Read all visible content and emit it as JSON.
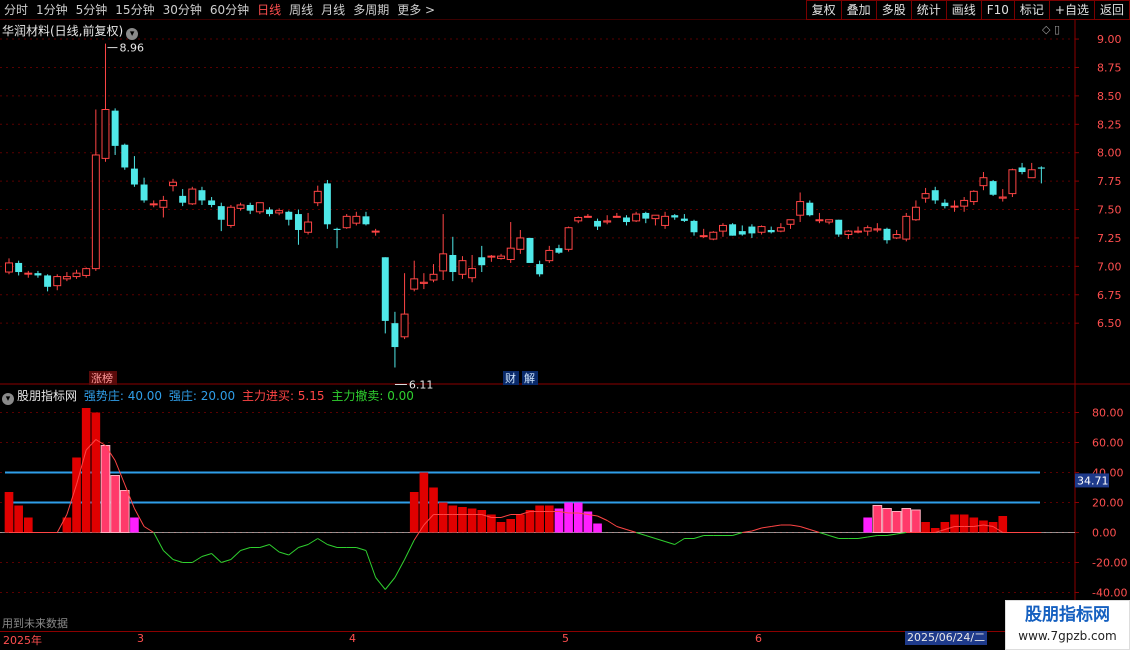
{
  "toolbar": {
    "periods": [
      {
        "label": "分时",
        "active": false
      },
      {
        "label": "1分钟",
        "active": false
      },
      {
        "label": "5分钟",
        "active": false
      },
      {
        "label": "15分钟",
        "active": false
      },
      {
        "label": "30分钟",
        "active": false
      },
      {
        "label": "60分钟",
        "active": false
      },
      {
        "label": "日线",
        "active": true
      },
      {
        "label": "周线",
        "active": false
      },
      {
        "label": "月线",
        "active": false
      },
      {
        "label": "多周期",
        "active": false
      },
      {
        "label": "更多 >",
        "active": false
      }
    ],
    "tools": [
      "复权",
      "叠加",
      "多股",
      "统计",
      "画线",
      "F10",
      "标记",
      "+自选",
      "返回"
    ]
  },
  "main": {
    "title": "华润材料(日线,前复权)",
    "title_icon": "chevron-down-icon",
    "panel_icons": "◇ ▯",
    "high_label": "8.96",
    "low_label": "6.11",
    "badges": [
      "涨榜",
      "财",
      "解"
    ],
    "price_axis": [
      "9.00",
      "8.75",
      "8.50",
      "8.25",
      "8.00",
      "7.75",
      "7.50",
      "7.25",
      "7.00",
      "6.75",
      "6.50"
    ]
  },
  "indicator": {
    "name": "股朋指标网",
    "strong": "强势庄: 40.00",
    "mid": "强庄: 20.00",
    "buy": "主力进买: 5.15",
    "sell": "主力撤卖: 0.00",
    "axis": [
      "80.00",
      "60.00",
      "40.00",
      "20.00",
      "0.00",
      "-20.00",
      "-40.00"
    ],
    "current_value": "34.71"
  },
  "footer": {
    "future_note": "用到未来数据",
    "dates": [
      "2025年",
      "3",
      "4",
      "5",
      "6"
    ],
    "cursor_date": "2025/06/24/二"
  },
  "watermark": {
    "line1": "股朋指标网",
    "line2": "www.7gpzb.com"
  },
  "colors": {
    "up": "#ff4545",
    "down": "#4fe8e8",
    "grid": "#5a0000",
    "line_blue": "#2f9ee8",
    "line_green": "#2fd02f",
    "magenta": "#ff1fff"
  },
  "chart_data": {
    "type": "candlestick",
    "candles": [
      [
        6.95,
        7.03,
        7.07,
        6.93
      ],
      [
        7.03,
        6.95,
        7.05,
        6.92
      ],
      [
        6.94,
        6.94,
        6.96,
        6.9
      ],
      [
        6.94,
        6.92,
        6.96,
        6.9
      ],
      [
        6.92,
        6.82,
        6.93,
        6.78
      ],
      [
        6.83,
        6.91,
        6.93,
        6.79
      ],
      [
        6.89,
        6.91,
        6.95,
        6.87
      ],
      [
        6.91,
        6.94,
        6.97,
        6.89
      ],
      [
        6.92,
        6.98,
        6.99,
        6.9
      ],
      [
        6.98,
        7.98,
        8.38,
        6.96
      ],
      [
        7.95,
        8.38,
        8.96,
        7.92
      ],
      [
        8.37,
        8.06,
        8.39,
        7.98
      ],
      [
        8.07,
        7.87,
        8.08,
        7.85
      ],
      [
        7.86,
        7.72,
        7.97,
        7.7
      ],
      [
        7.72,
        7.58,
        7.78,
        7.56
      ],
      [
        7.55,
        7.55,
        7.58,
        7.52
      ],
      [
        7.52,
        7.58,
        7.62,
        7.43
      ],
      [
        7.71,
        7.74,
        7.77,
        7.66
      ],
      [
        7.62,
        7.56,
        7.68,
        7.53
      ],
      [
        7.55,
        7.68,
        7.7,
        7.54
      ],
      [
        7.67,
        7.58,
        7.7,
        7.54
      ],
      [
        7.58,
        7.54,
        7.61,
        7.52
      ],
      [
        7.53,
        7.41,
        7.56,
        7.31
      ],
      [
        7.36,
        7.52,
        7.54,
        7.34
      ],
      [
        7.51,
        7.54,
        7.56,
        7.49
      ],
      [
        7.54,
        7.49,
        7.56,
        7.46
      ],
      [
        7.48,
        7.56,
        7.56,
        7.46
      ],
      [
        7.5,
        7.46,
        7.52,
        7.44
      ],
      [
        7.47,
        7.49,
        7.51,
        7.45
      ],
      [
        7.48,
        7.41,
        7.49,
        7.36
      ],
      [
        7.46,
        7.32,
        7.5,
        7.19
      ],
      [
        7.3,
        7.39,
        7.47,
        7.28
      ],
      [
        7.56,
        7.66,
        7.71,
        7.53
      ],
      [
        7.73,
        7.37,
        7.76,
        7.33
      ],
      [
        7.33,
        7.32,
        7.34,
        7.16
      ],
      [
        7.34,
        7.44,
        7.46,
        7.33
      ],
      [
        7.38,
        7.44,
        7.48,
        7.36
      ],
      [
        7.44,
        7.37,
        7.48,
        7.36
      ],
      [
        7.31,
        7.31,
        7.33,
        7.27
      ],
      [
        7.08,
        6.52,
        7.08,
        6.41
      ],
      [
        6.5,
        6.29,
        6.6,
        6.11
      ],
      [
        6.38,
        6.58,
        6.94,
        6.36
      ],
      [
        6.8,
        6.89,
        7.05,
        6.78
      ],
      [
        6.85,
        6.86,
        6.94,
        6.8
      ],
      [
        6.88,
        6.93,
        7.02,
        6.86
      ],
      [
        6.96,
        7.11,
        7.46,
        6.88
      ],
      [
        7.1,
        6.95,
        7.26,
        6.87
      ],
      [
        6.93,
        7.05,
        7.09,
        6.89
      ],
      [
        6.9,
        6.98,
        7.1,
        6.86
      ],
      [
        7.08,
        7.01,
        7.18,
        6.95
      ],
      [
        7.09,
        7.09,
        7.1,
        7.04
      ],
      [
        7.07,
        7.09,
        7.11,
        7.06
      ],
      [
        7.06,
        7.16,
        7.39,
        7.03
      ],
      [
        7.15,
        7.25,
        7.32,
        7.11
      ],
      [
        7.25,
        7.03,
        7.25,
        7.03
      ],
      [
        7.02,
        6.93,
        7.05,
        6.91
      ],
      [
        7.05,
        7.14,
        7.18,
        7.03
      ],
      [
        7.16,
        7.12,
        7.19,
        7.11
      ],
      [
        7.15,
        7.34,
        7.35,
        7.13
      ],
      [
        7.4,
        7.43,
        7.44,
        7.38
      ],
      [
        7.44,
        7.44,
        7.46,
        7.44
      ],
      [
        7.4,
        7.35,
        7.42,
        7.32
      ],
      [
        7.39,
        7.4,
        7.45,
        7.37
      ],
      [
        7.44,
        7.44,
        7.47,
        7.43
      ],
      [
        7.43,
        7.39,
        7.45,
        7.36
      ],
      [
        7.4,
        7.46,
        7.48,
        7.39
      ],
      [
        7.47,
        7.42,
        7.48,
        7.38
      ],
      [
        7.42,
        7.45,
        7.45,
        7.36
      ],
      [
        7.36,
        7.44,
        7.48,
        7.33
      ],
      [
        7.45,
        7.43,
        7.46,
        7.41
      ],
      [
        7.42,
        7.4,
        7.46,
        7.39
      ],
      [
        7.4,
        7.3,
        7.41,
        7.27
      ],
      [
        7.27,
        7.27,
        7.33,
        7.25
      ],
      [
        7.24,
        7.3,
        7.31,
        7.23
      ],
      [
        7.31,
        7.36,
        7.38,
        7.26
      ],
      [
        7.37,
        7.27,
        7.38,
        7.27
      ],
      [
        7.31,
        7.28,
        7.36,
        7.27
      ],
      [
        7.35,
        7.29,
        7.37,
        7.25
      ],
      [
        7.3,
        7.35,
        7.36,
        7.28
      ],
      [
        7.32,
        7.3,
        7.35,
        7.29
      ],
      [
        7.31,
        7.34,
        7.38,
        7.3
      ],
      [
        7.37,
        7.41,
        7.41,
        7.33
      ],
      [
        7.45,
        7.57,
        7.65,
        7.39
      ],
      [
        7.56,
        7.45,
        7.58,
        7.44
      ],
      [
        7.41,
        7.41,
        7.47,
        7.38
      ],
      [
        7.39,
        7.41,
        7.41,
        7.37
      ],
      [
        7.41,
        7.28,
        7.41,
        7.26
      ],
      [
        7.28,
        7.31,
        7.32,
        7.24
      ],
      [
        7.31,
        7.31,
        7.35,
        7.29
      ],
      [
        7.31,
        7.34,
        7.36,
        7.27
      ],
      [
        7.32,
        7.33,
        7.38,
        7.3
      ],
      [
        7.33,
        7.23,
        7.34,
        7.2
      ],
      [
        7.25,
        7.28,
        7.32,
        7.24
      ],
      [
        7.24,
        7.44,
        7.47,
        7.22
      ],
      [
        7.41,
        7.52,
        7.58,
        7.4
      ],
      [
        7.6,
        7.64,
        7.69,
        7.56
      ],
      [
        7.67,
        7.58,
        7.7,
        7.55
      ],
      [
        7.56,
        7.53,
        7.59,
        7.51
      ],
      [
        7.53,
        7.53,
        7.58,
        7.48
      ],
      [
        7.53,
        7.58,
        7.61,
        7.48
      ],
      [
        7.57,
        7.66,
        7.67,
        7.54
      ],
      [
        7.71,
        7.78,
        7.83,
        7.67
      ],
      [
        7.75,
        7.63,
        7.76,
        7.62
      ],
      [
        7.6,
        7.61,
        7.68,
        7.57
      ],
      [
        7.64,
        7.85,
        7.86,
        7.61
      ],
      [
        7.87,
        7.83,
        7.91,
        7.81
      ],
      [
        7.78,
        7.85,
        7.91,
        7.81
      ],
      [
        7.87,
        7.86,
        7.88,
        7.73
      ]
    ],
    "price_range": [
      6.0,
      9.15
    ],
    "indicator_bars": [
      [
        27,
        0
      ],
      [
        18,
        0
      ],
      [
        10,
        0
      ],
      [
        0,
        0
      ],
      [
        0,
        0
      ],
      [
        0,
        0
      ],
      [
        10,
        0
      ],
      [
        50,
        0
      ],
      [
        83,
        0
      ],
      [
        80,
        0
      ],
      [
        58,
        1
      ],
      [
        38,
        1
      ],
      [
        28,
        1
      ],
      [
        10,
        2
      ],
      [
        0,
        0
      ],
      [
        0,
        0
      ],
      [
        0,
        0
      ],
      [
        0,
        0
      ],
      [
        0,
        0
      ],
      [
        0,
        0
      ],
      [
        0,
        0
      ],
      [
        0,
        0
      ],
      [
        0,
        0
      ],
      [
        0,
        0
      ],
      [
        0,
        0
      ],
      [
        0,
        0
      ],
      [
        0,
        0
      ],
      [
        0,
        0
      ],
      [
        0,
        0
      ],
      [
        0,
        0
      ],
      [
        0,
        0
      ],
      [
        0,
        0
      ],
      [
        0,
        0
      ],
      [
        0,
        0
      ],
      [
        0,
        0
      ],
      [
        0,
        0
      ],
      [
        0,
        0
      ],
      [
        0,
        0
      ],
      [
        0,
        0
      ],
      [
        0,
        0
      ],
      [
        0,
        0
      ],
      [
        0,
        0
      ],
      [
        27,
        0
      ],
      [
        40,
        0
      ],
      [
        30,
        0
      ],
      [
        20,
        0
      ],
      [
        18,
        0
      ],
      [
        17,
        0
      ],
      [
        16,
        0
      ],
      [
        15,
        0
      ],
      [
        12,
        0
      ],
      [
        7,
        0
      ],
      [
        9,
        0
      ],
      [
        12,
        0
      ],
      [
        15,
        0
      ],
      [
        18,
        0
      ],
      [
        18,
        0
      ],
      [
        16,
        2
      ],
      [
        20,
        2
      ],
      [
        20,
        2
      ],
      [
        14,
        2
      ],
      [
        6,
        2
      ],
      [
        0,
        0
      ],
      [
        0,
        0
      ],
      [
        0,
        0
      ],
      [
        0,
        0
      ],
      [
        0,
        0
      ],
      [
        0,
        0
      ],
      [
        0,
        0
      ],
      [
        0,
        0
      ],
      [
        0,
        0
      ],
      [
        0,
        0
      ],
      [
        0,
        0
      ],
      [
        0,
        0
      ],
      [
        0,
        0
      ],
      [
        0,
        0
      ],
      [
        0,
        0
      ],
      [
        0,
        0
      ],
      [
        0,
        0
      ],
      [
        0,
        0
      ],
      [
        0,
        0
      ],
      [
        0,
        0
      ],
      [
        0,
        0
      ],
      [
        0,
        0
      ],
      [
        0,
        0
      ],
      [
        0,
        0
      ],
      [
        0,
        0
      ],
      [
        0,
        0
      ],
      [
        0,
        0
      ],
      [
        10,
        2
      ],
      [
        18,
        1
      ],
      [
        16,
        1
      ],
      [
        14,
        1
      ],
      [
        16,
        1
      ],
      [
        15,
        1
      ],
      [
        7,
        0
      ],
      [
        3,
        0
      ],
      [
        7,
        0
      ],
      [
        12,
        0
      ],
      [
        12,
        0
      ],
      [
        10,
        0
      ],
      [
        8,
        0
      ],
      [
        7,
        0
      ],
      [
        11,
        0
      ],
      [
        0,
        0
      ],
      [
        0,
        0
      ],
      [
        0,
        0
      ],
      [
        0,
        0
      ]
    ],
    "buy_line": [
      0,
      0,
      0,
      0,
      0,
      0,
      12,
      32,
      55,
      62,
      58,
      48,
      32,
      16,
      4,
      0,
      -12,
      -18,
      -20,
      -20,
      -16,
      -14,
      -20,
      -18,
      -12,
      -10,
      -10,
      -8,
      -13,
      -15,
      -10,
      -8,
      -4,
      -8,
      -10,
      -10,
      -10,
      -12,
      -30,
      -38,
      -30,
      -18,
      -5,
      5,
      12,
      12,
      12,
      12,
      12,
      12,
      10,
      10,
      12,
      12,
      14,
      14,
      14,
      14,
      13,
      13,
      12,
      11,
      8,
      4,
      2,
      0,
      -2,
      -4,
      -6,
      -8,
      -4,
      -4,
      -2,
      -2,
      -2,
      -2,
      0,
      1,
      3,
      4,
      5,
      5,
      4,
      2,
      0,
      -2,
      -4,
      -4,
      -4,
      -3,
      -2,
      -2,
      -1,
      0,
      0,
      0,
      0,
      2,
      4,
      4,
      4,
      5,
      4,
      0,
      0,
      0,
      0,
      0
    ],
    "indicator_range": [
      -45,
      87
    ],
    "levels": [
      40,
      20
    ]
  }
}
